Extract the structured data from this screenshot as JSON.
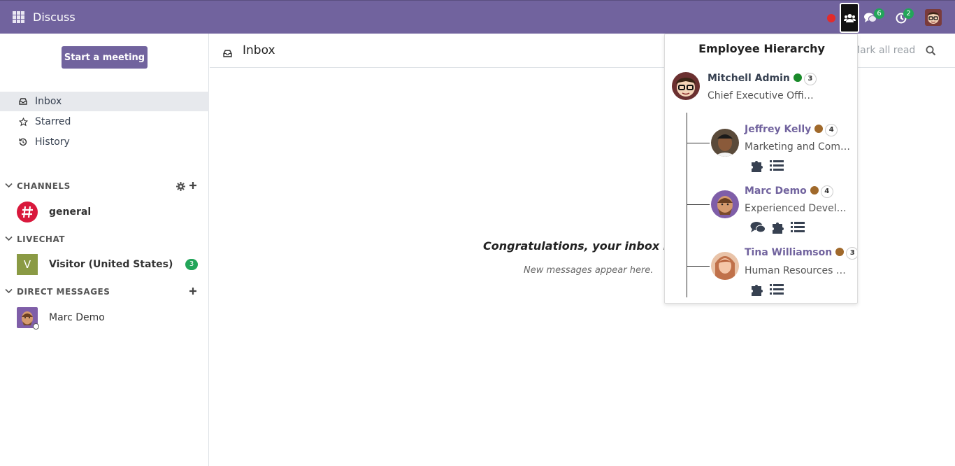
{
  "topbar": {
    "app_name": "Discuss",
    "messages_badge": "6",
    "activities_badge": "2",
    "accent": "#71639e"
  },
  "sidebar": {
    "start_meeting": "Start a meeting",
    "mailboxes": [
      {
        "label": "Inbox",
        "icon": "inbox-icon",
        "active": true
      },
      {
        "label": "Starred",
        "icon": "star-icon",
        "active": false
      },
      {
        "label": "History",
        "icon": "history-icon",
        "active": false
      }
    ],
    "channels": {
      "header": "CHANNELS",
      "items": [
        {
          "name": "general"
        }
      ]
    },
    "livechat": {
      "header": "LIVECHAT",
      "items": [
        {
          "name": "Visitor (United States)",
          "initial": "V",
          "badge": "3"
        }
      ]
    },
    "direct_messages": {
      "header": "DIRECT MESSAGES",
      "items": [
        {
          "name": "Marc Demo"
        }
      ]
    }
  },
  "main": {
    "title": "Inbox",
    "mark_all_read": "Mark all read",
    "empty_title": "Congratulations, your inbox is em",
    "empty_subtitle": "New messages appear here."
  },
  "hierarchy": {
    "title": "Employee Hierarchy",
    "manager": {
      "name": "Mitchell Admin",
      "job": "Chief Executive Officer",
      "count": "3",
      "status_color": "#1a8a2a"
    },
    "reports": [
      {
        "name": "Jeffrey Kelly",
        "job": "Marketing and Comm…",
        "count": "4",
        "status_color": "#a0692b"
      },
      {
        "name": "Marc Demo",
        "job": "Experienced Developer",
        "count": "4",
        "status_color": "#a0692b"
      },
      {
        "name": "Tina Williamson",
        "job": "Human Resources M…",
        "count": "3",
        "status_color": "#a0692b"
      }
    ]
  }
}
